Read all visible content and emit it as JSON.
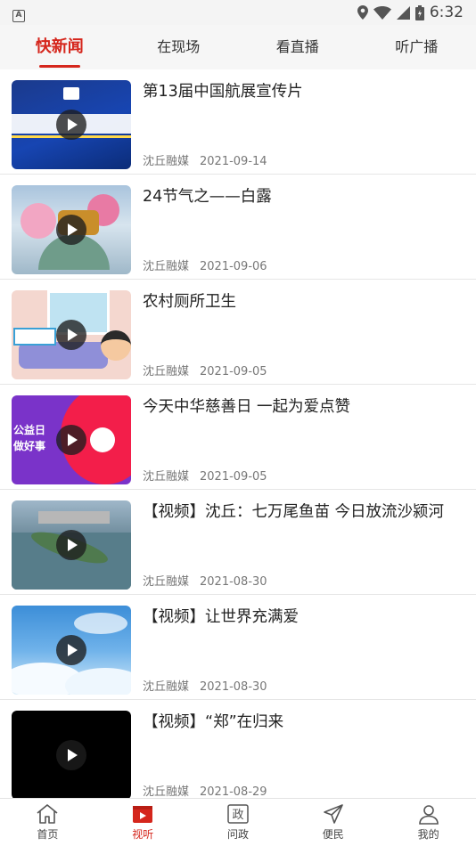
{
  "status_bar": {
    "time": "6:32",
    "left_badge": "A"
  },
  "tabs": [
    {
      "label": "快新闻",
      "active": true
    },
    {
      "label": "在现场",
      "active": false
    },
    {
      "label": "看直播",
      "active": false
    },
    {
      "label": "听广播",
      "active": false
    }
  ],
  "items": [
    {
      "title": "第13届中国航展宣传片",
      "source": "沈丘融媒",
      "date": "2021-09-14"
    },
    {
      "title": "24节气之——白露",
      "source": "沈丘融媒",
      "date": "2021-09-06"
    },
    {
      "title": "农村厕所卫生",
      "source": "沈丘融媒",
      "date": "2021-09-05"
    },
    {
      "title": "今天中华慈善日 一起为爱点赞",
      "source": "沈丘融媒",
      "date": "2021-09-05"
    },
    {
      "title": "【视频】沈丘：七万尾鱼苗 今日放流沙颍河",
      "source": "沈丘融媒",
      "date": "2021-08-30"
    },
    {
      "title": "【视频】让世界充满爱",
      "source": "沈丘融媒",
      "date": "2021-08-30"
    },
    {
      "title": "【视频】“郑”在归来",
      "source": "沈丘融媒",
      "date": "2021-08-29"
    }
  ],
  "thumb_text": {
    "t4_line1": "公益日",
    "t4_line2": "做好事"
  },
  "bottom_nav": [
    {
      "label": "首页",
      "icon": "home-icon",
      "active": false
    },
    {
      "label": "视听",
      "icon": "video-icon",
      "active": true
    },
    {
      "label": "问政",
      "icon": "zheng-icon",
      "active": false
    },
    {
      "label": "便民",
      "icon": "send-icon",
      "active": false
    },
    {
      "label": "我的",
      "icon": "user-icon",
      "active": false
    }
  ],
  "colors": {
    "accent": "#d5261c",
    "tab_bg": "#f6f6f6",
    "divider": "#e6e6e6"
  }
}
